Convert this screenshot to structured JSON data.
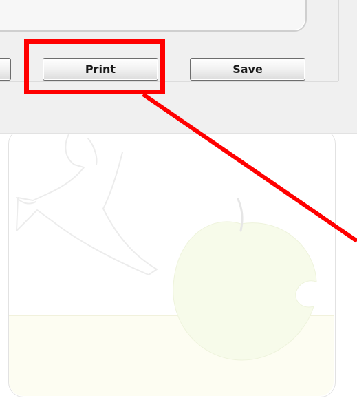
{
  "buttons": {
    "left_label": "",
    "print_label": "Print",
    "save_label": "Save"
  },
  "annotation": {
    "color": "#ff0000",
    "target": "print-button"
  },
  "colors": {
    "dialog_background": "#f0f0f0",
    "button_border": "#6d6d6d",
    "artwork_apple": "#f7fbea",
    "artwork_band": "#fdfdf2"
  }
}
